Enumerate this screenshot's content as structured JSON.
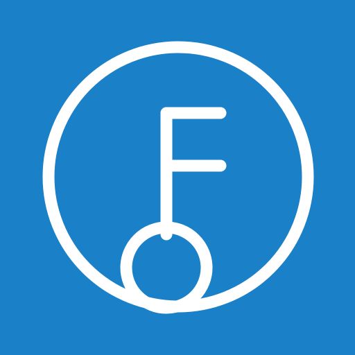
{
  "app_icon": {
    "icon": "circled-f-key-logo-icon",
    "colors": {
      "background": "#1A80C8",
      "foreground": "#FFFFFF"
    }
  }
}
